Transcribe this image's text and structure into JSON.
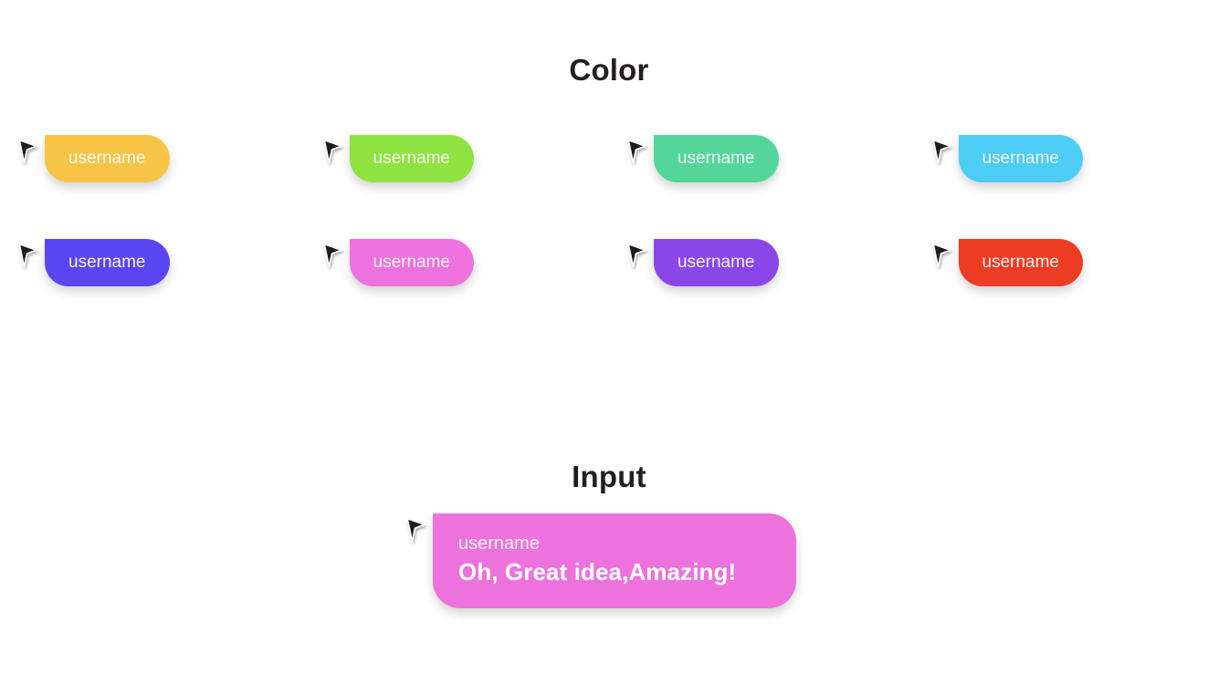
{
  "sections": {
    "color": {
      "heading": "Color",
      "bubbles": [
        {
          "label": "username",
          "color": "#f8c council"
        }
      ]
    }
  },
  "color_section": {
    "heading": "Color",
    "cursor_icon": "cursor-arrow-icon",
    "bubbles": [
      {
        "username": "username",
        "color": "#f7c445"
      },
      {
        "username": "username",
        "color": "#8ee33f"
      },
      {
        "username": "username",
        "color": "#54d69b"
      },
      {
        "username": "username",
        "color": "#4ccdf5"
      },
      {
        "username": "username",
        "color": "#5b45f0"
      },
      {
        "username": "username",
        "color": "#ee72dd"
      },
      {
        "username": "username",
        "color": "#8b46e8"
      },
      {
        "username": "username",
        "color": "#ec3c22"
      }
    ]
  },
  "input_section": {
    "heading": "Input",
    "cursor_icon": "cursor-arrow-icon",
    "bubble": {
      "username": "username",
      "message": "Oh, Great idea,Amazing!",
      "color": "#ee72dd"
    }
  }
}
